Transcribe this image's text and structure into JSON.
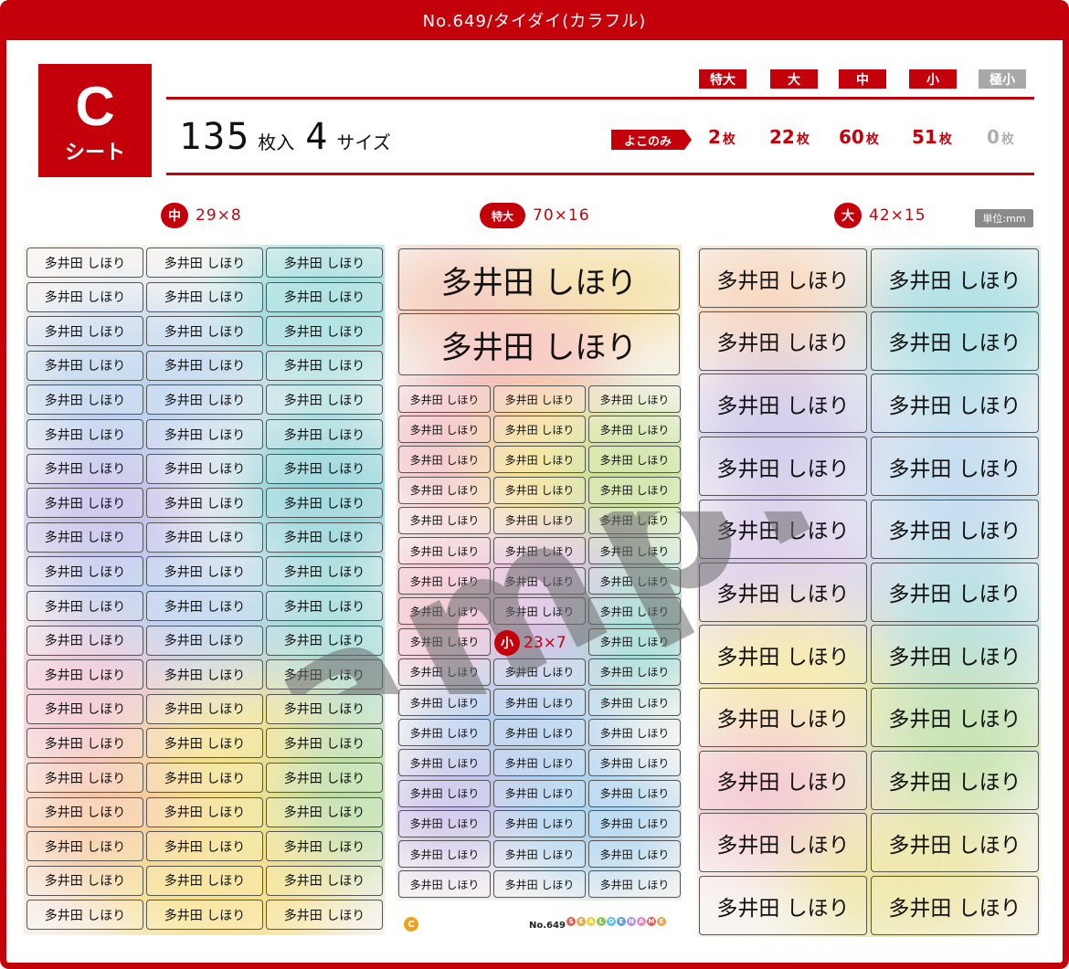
{
  "header": {
    "title": "No.649/タイダイ(カラフル)"
  },
  "badge": {
    "letter": "C",
    "word": "シート"
  },
  "summary": {
    "count": "135",
    "count_unit": "枚入",
    "sizes": "4",
    "sizes_unit": "サイズ"
  },
  "sizes": [
    {
      "label": "特大",
      "count": "2",
      "active": true
    },
    {
      "label": "大",
      "count": "22",
      "active": true
    },
    {
      "label": "中",
      "count": "60",
      "active": true
    },
    {
      "label": "小",
      "count": "51",
      "active": true
    },
    {
      "label": "極小",
      "count": "0",
      "active": false
    }
  ],
  "count_suffix": "枚",
  "yoko_label": "よこのみ",
  "sections": {
    "medium": {
      "badge": "中",
      "dims": "29×8"
    },
    "xlarge": {
      "badge": "特大",
      "dims": "70×16"
    },
    "large": {
      "badge": "大",
      "dims": "42×15"
    },
    "small": {
      "badge": "小",
      "dims": "23×7"
    },
    "unit_label": "単位:mm"
  },
  "label_text": "多井田 しほり",
  "watermark": "sample",
  "footer": {
    "sheet_letter": "C",
    "product_no": "No.649",
    "brand": "SEAL DE NAME"
  },
  "colors": {
    "accent": "#c4000b",
    "inactive": "#a8a8a8"
  }
}
